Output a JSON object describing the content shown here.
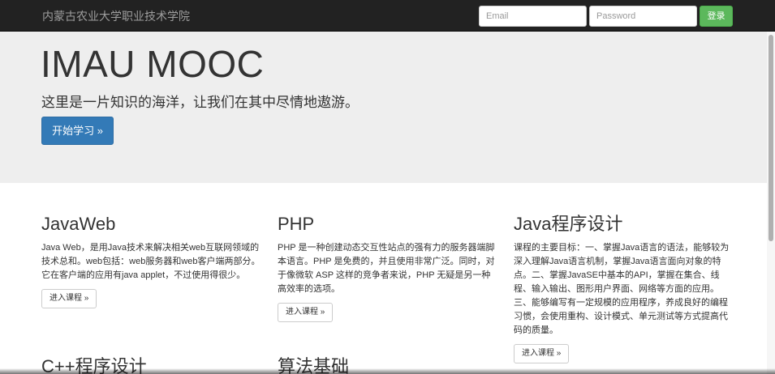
{
  "navbar": {
    "brand": "内蒙古农业大学职业技术学院",
    "email_placeholder": "Email",
    "password_placeholder": "Password",
    "login_label": "登录"
  },
  "jumbotron": {
    "title": "IMAU MOOC",
    "subtitle": "这里是一片知识的海洋，让我们在其中尽情地遨游。",
    "start_label": "开始学习 »"
  },
  "courses": [
    {
      "title": "JavaWeb",
      "description": "Java Web，是用Java技术来解决相关web互联网领域的技术总和。web包括：web服务器和web客户端两部分。它在客户端的应用有java applet，不过使用得很少。",
      "button": "进入课程 »"
    },
    {
      "title": "PHP",
      "description": "PHP 是一种创建动态交互性站点的强有力的服务器端脚本语言。PHP 是免费的，并且使用非常广泛。同时，对于像微软 ASP 这样的竞争者来说，PHP 无疑是另一种高效率的选项。",
      "button": "进入课程 »"
    },
    {
      "title": "Java程序设计",
      "description": "课程的主要目标：一、掌握Java语言的语法，能够较为深入理解Java语言机制，掌握Java语言面向对象的特点。二、掌握JavaSE中基本的API，掌握在集合、线程、输入输出、图形用户界面、网络等方面的应用。三、能够编写有一定规模的应用程序，养成良好的编程习惯，会使用重构、设计模式、单元测试等方式提高代码的质量。",
      "button": "进入课程 »"
    },
    {
      "title": "C++程序设计"
    },
    {
      "title": "算法基础"
    }
  ]
}
